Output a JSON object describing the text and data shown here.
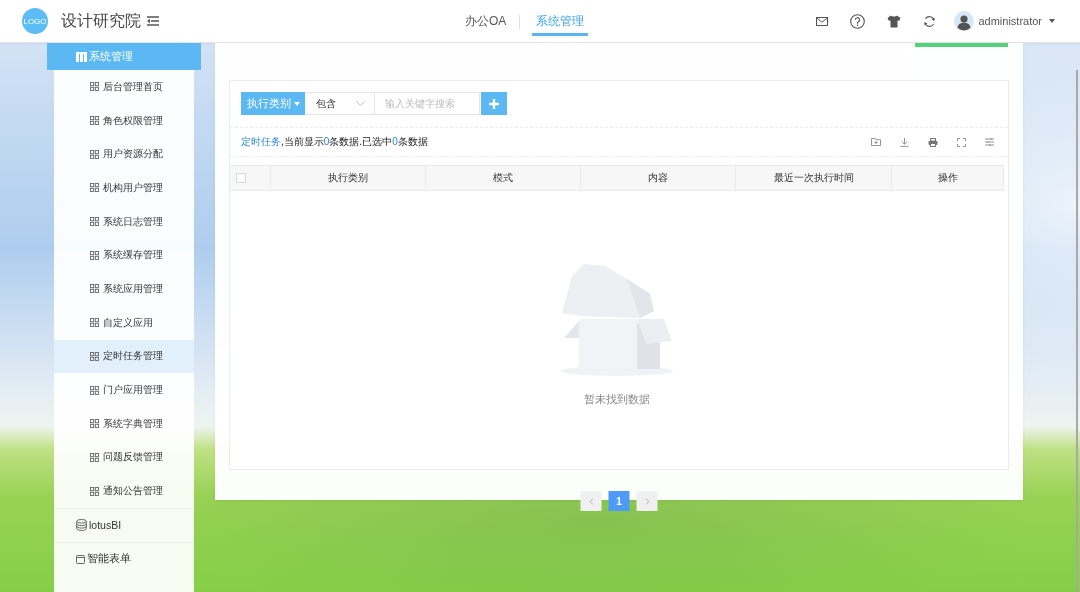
{
  "header": {
    "logo": "LOGO",
    "title": "设计研究院",
    "nav": [
      {
        "label": "办公OA",
        "selected": false
      },
      {
        "label": "系统管理",
        "selected": true
      }
    ],
    "user": {
      "name": "administrator"
    }
  },
  "sidebar": {
    "items": [
      {
        "label": "系统管理",
        "expanded": true,
        "children": [
          {
            "label": "后台管理首页",
            "selected": false
          },
          {
            "label": "角色权限管理",
            "selected": false
          },
          {
            "label": "用户资源分配",
            "selected": false
          },
          {
            "label": "机构用户管理",
            "selected": false
          },
          {
            "label": "系统日志管理",
            "selected": false
          },
          {
            "label": "系统缓存管理",
            "selected": false
          },
          {
            "label": "系统应用管理",
            "selected": false
          },
          {
            "label": "自定义应用",
            "selected": false
          },
          {
            "label": "定时任务管理",
            "selected": true
          },
          {
            "label": "门户应用管理",
            "selected": false
          },
          {
            "label": "系统字典管理",
            "selected": false
          },
          {
            "label": "问题反馈管理",
            "selected": false
          },
          {
            "label": "通知公告管理",
            "selected": false
          }
        ]
      },
      {
        "label": "lotusBI",
        "expanded": false
      },
      {
        "label": "智能表单",
        "expanded": false
      }
    ]
  },
  "main": {
    "toolbar": {
      "filter_button": "执行类别",
      "operator": "包含",
      "search": {
        "placeholder": "输入关键字搜索"
      }
    },
    "summary": [
      {
        "text": "定时任务",
        "highlight": true
      },
      {
        "text": ",当前显示",
        "highlight": false
      },
      {
        "text": "0",
        "highlight": true
      },
      {
        "text": "条数据.已选中",
        "highlight": false
      },
      {
        "text": "0",
        "highlight": true
      },
      {
        "text": "条数据",
        "highlight": false
      }
    ],
    "table": {
      "select_all": {
        "checked": false
      },
      "columns": [
        "执行类别",
        "模式",
        "内容",
        "最近一次执行时间",
        "操作"
      ],
      "empty_text": "暂未找到数据"
    },
    "pagination": {
      "pages": [
        {
          "label": "1",
          "selected": true
        }
      ]
    }
  }
}
